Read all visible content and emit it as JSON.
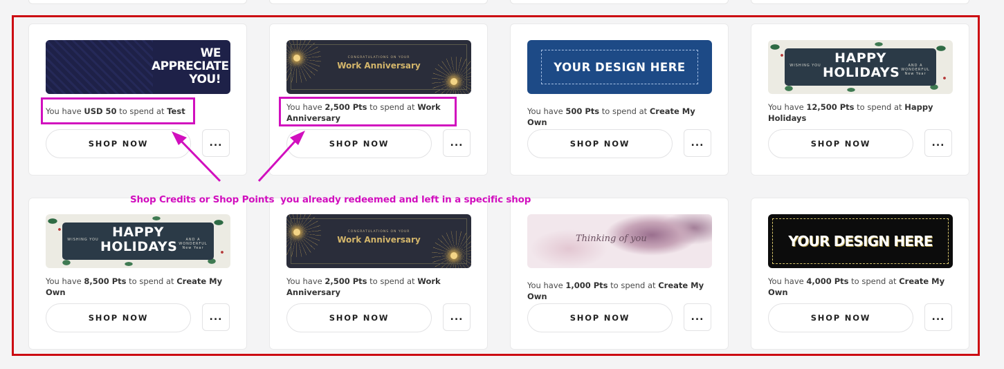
{
  "cards": [
    {
      "prefix": "You have ",
      "amount": "USD 50",
      "middle": " to spend at ",
      "shop": "Test",
      "banner_text": "WE APPRECIATE YOU!",
      "button": "SHOP NOW",
      "more": "..."
    },
    {
      "prefix": "You have ",
      "amount": "2,500 Pts",
      "middle": " to spend at ",
      "shop": "Work Anniversary",
      "banner_small": "CONGRATULATIONS ON YOUR",
      "banner_text": "Work Anniversary",
      "button": "SHOP NOW",
      "more": "..."
    },
    {
      "prefix": "You have ",
      "amount": "500 Pts",
      "middle": " to spend at ",
      "shop": "Create My Own",
      "banner_text": "YOUR DESIGN HERE",
      "button": "SHOP NOW",
      "more": "..."
    },
    {
      "prefix": "You have ",
      "amount": "12,500 Pts",
      "middle": " to spend at ",
      "shop": "Happy Holidays",
      "banner_text": "HAPPY HOLIDAYS",
      "banner_left": "WISHING YOU",
      "banner_right": "AND A WONDERFUL New Year",
      "button": "SHOP NOW",
      "more": "..."
    },
    {
      "prefix": "You have ",
      "amount": "8,500 Pts",
      "middle": " to spend at ",
      "shop": "Create My Own",
      "banner_text": "HAPPY HOLIDAYS",
      "banner_left": "WISHING YOU",
      "banner_right": "AND A WONDERFUL New Year",
      "button": "SHOP NOW",
      "more": "..."
    },
    {
      "prefix": "You have ",
      "amount": "2,500 Pts",
      "middle": " to spend at ",
      "shop": "Work Anniversary",
      "banner_small": "CONGRATULATIONS ON YOUR",
      "banner_text": "Work Anniversary",
      "button": "SHOP NOW",
      "more": "..."
    },
    {
      "prefix": "You have ",
      "amount": "1,000 Pts",
      "middle": " to spend at ",
      "shop": "Create My Own",
      "banner_text": "Thinking of you",
      "button": "SHOP NOW",
      "more": "..."
    },
    {
      "prefix": "You have ",
      "amount": "4,000 Pts",
      "middle": " to spend at ",
      "shop": "Create My Own",
      "banner_text": "YOUR DESIGN HERE",
      "button": "SHOP NOW",
      "more": "..."
    }
  ],
  "annotation": {
    "caption": "Shop Credits or Shop Points  you already redeemed and left in a specific shop",
    "color": "#d10fbe",
    "frame_color": "#cc0a12"
  }
}
